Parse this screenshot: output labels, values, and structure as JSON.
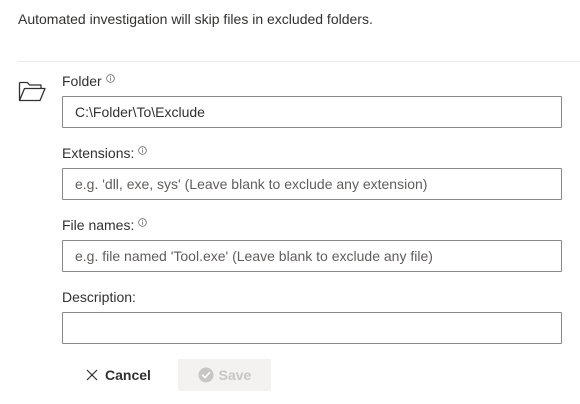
{
  "intro_text": "Automated investigation will skip files in excluded folders.",
  "fields": {
    "folder": {
      "label": "Folder",
      "value": "C:\\Folder\\To\\Exclude"
    },
    "extensions": {
      "label": "Extensions:",
      "placeholder": "e.g. 'dll, exe, sys' (Leave blank to exclude any extension)"
    },
    "file_names": {
      "label": "File names:",
      "placeholder": "e.g. file named 'Tool.exe' (Leave blank to exclude any file)"
    },
    "description": {
      "label": "Description:",
      "value": ""
    }
  },
  "buttons": {
    "cancel_label": "Cancel",
    "save_label": "Save",
    "save_enabled": false
  },
  "icons": {
    "folder": "folder-open-icon",
    "info": "info-icon",
    "cancel": "close-icon",
    "save": "checkmark-circle-icon"
  },
  "colors": {
    "text": "#323130",
    "border": "#8a8886",
    "placeholder": "#605e5c",
    "disabled_bg": "#f3f2f1",
    "disabled_text": "#c8c6c4"
  }
}
